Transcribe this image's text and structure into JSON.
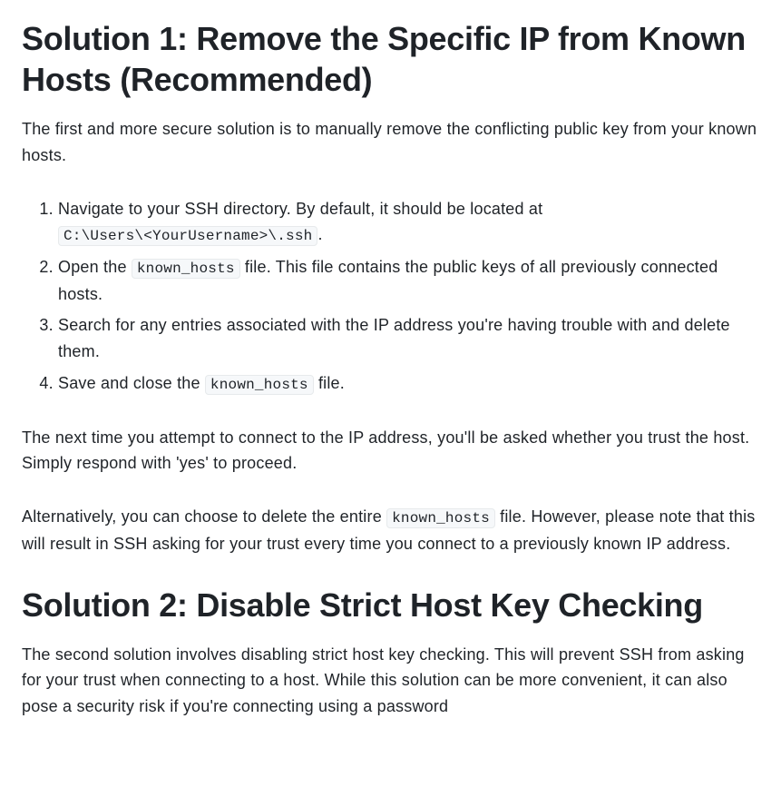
{
  "solution1": {
    "heading": "Solution 1: Remove the Specific IP from Known Hosts (Recommended)",
    "intro": "The first and more secure solution is to manually remove the conflicting public key from your known hosts.",
    "steps": {
      "s1a": "Navigate to your SSH directory. By default, it should be located at ",
      "s1code": "C:\\Users\\<YourUsername>\\.ssh",
      "s1b": ".",
      "s2a": "Open the ",
      "s2code": "known_hosts",
      "s2b": " file. This file contains the public keys of all previously connected hosts.",
      "s3": "Search for any entries associated with the IP address you're having trouble with and delete them.",
      "s4a": "Save and close the ",
      "s4code": "known_hosts",
      "s4b": " file."
    },
    "after1": "The next time you attempt to connect to the IP address, you'll be asked whether you trust the host. Simply respond with 'yes' to proceed.",
    "after2a": "Alternatively, you can choose to delete the entire ",
    "after2code": "known_hosts",
    "after2b": " file. However, please note that this will result in SSH asking for your trust every time you connect to a previously known IP address."
  },
  "solution2": {
    "heading": "Solution 2: Disable Strict Host Key Checking",
    "intro": "The second solution involves disabling strict host key checking. This will prevent SSH from asking for your trust when connecting to a host. While this solution can be more convenient, it can also pose a security risk if you're connecting using a password"
  }
}
